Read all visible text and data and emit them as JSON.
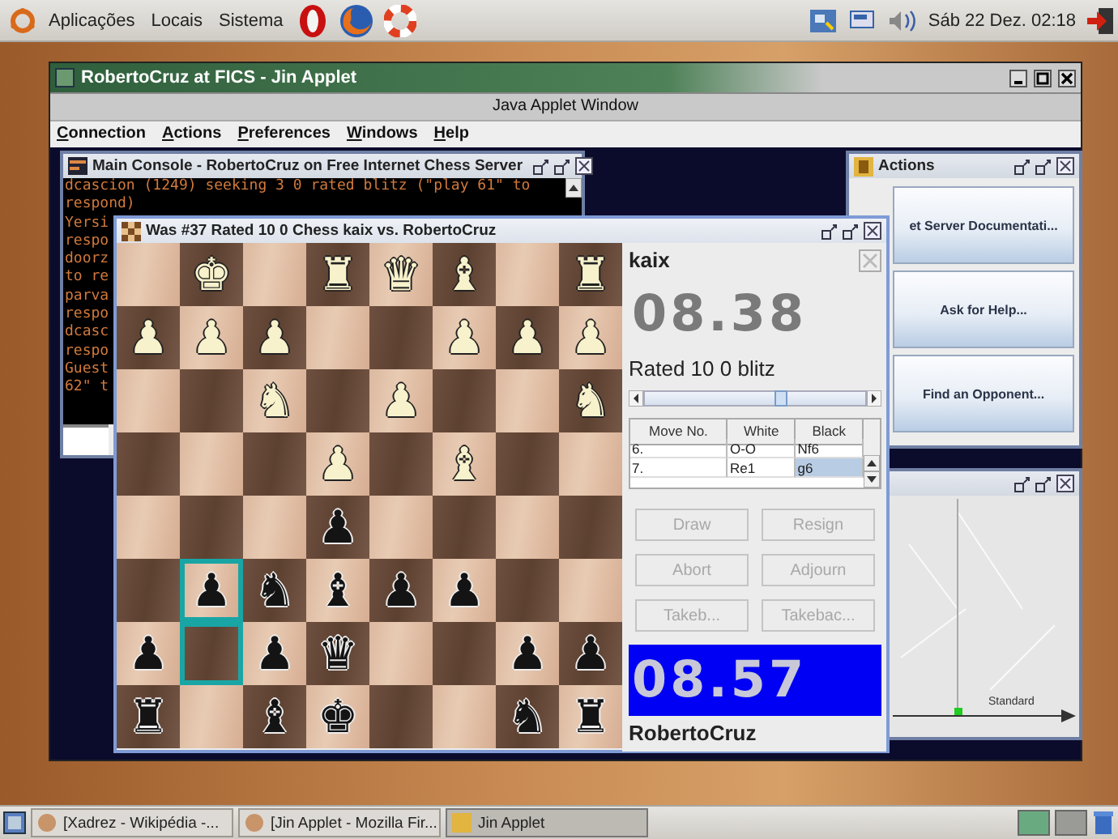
{
  "top_panel": {
    "menus": [
      "Aplicações",
      "Locais",
      "Sistema"
    ],
    "clock": "Sáb 22 Dez. 02:18"
  },
  "app_window": {
    "title": "RobertoCruz at FICS - Jin Applet",
    "banner": "Java Applet Window",
    "menu": [
      "Connection",
      "Actions",
      "Preferences",
      "Windows",
      "Help"
    ]
  },
  "console": {
    "title": "Main Console - RobertoCruz on Free Internet Chess Server",
    "lines": [
      "dcascion (1249) seeking 3 0 rated blitz (\"play 61\" to",
      "respond)",
      "Yersi",
      "respo",
      "doorz",
      "to re",
      "parva",
      "respo",
      "dcasc",
      "respo",
      "Guest",
      "62\" t"
    ]
  },
  "game": {
    "title": "Was #37 Rated 10 0 Chess kaix vs. RobertoCruz",
    "board": [
      [
        {
          "highlighted": false
        },
        {
          "piece": "♚",
          "kind": "white",
          "highlighted": false
        },
        {
          "highlighted": false
        },
        {
          "piece": "♜",
          "kind": "white",
          "highlighted": false
        },
        {
          "piece": "♛",
          "kind": "white",
          "highlighted": false
        },
        {
          "piece": "♝",
          "kind": "white",
          "highlighted": false
        },
        {
          "highlighted": false
        },
        {
          "piece": "♜",
          "kind": "white",
          "highlighted": false
        }
      ],
      [
        {
          "piece": "♟",
          "kind": "white",
          "highlighted": false
        },
        {
          "piece": "♟",
          "kind": "white",
          "highlighted": false
        },
        {
          "piece": "♟",
          "kind": "white",
          "highlighted": false
        },
        {
          "highlighted": false
        },
        {
          "highlighted": false
        },
        {
          "piece": "♟",
          "kind": "white",
          "highlighted": false
        },
        {
          "piece": "♟",
          "kind": "white",
          "highlighted": false
        },
        {
          "piece": "♟",
          "kind": "white",
          "highlighted": false
        }
      ],
      [
        {
          "highlighted": false
        },
        {
          "highlighted": false
        },
        {
          "piece": "♞",
          "kind": "white",
          "highlighted": false
        },
        {
          "highlighted": false
        },
        {
          "piece": "♟",
          "kind": "white",
          "highlighted": false
        },
        {
          "highlighted": false
        },
        {
          "highlighted": false
        },
        {
          "piece": "♞",
          "kind": "white",
          "highlighted": false
        }
      ],
      [
        {
          "highlighted": false
        },
        {
          "highlighted": false
        },
        {
          "highlighted": false
        },
        {
          "piece": "♟",
          "kind": "white",
          "highlighted": false
        },
        {
          "highlighted": false
        },
        {
          "piece": "♝",
          "kind": "white",
          "highlighted": false
        },
        {
          "highlighted": false
        },
        {
          "highlighted": false
        }
      ],
      [
        {
          "highlighted": false
        },
        {
          "highlighted": false
        },
        {
          "highlighted": false
        },
        {
          "piece": "♟",
          "kind": "black",
          "highlighted": false
        },
        {
          "highlighted": false
        },
        {
          "highlighted": false
        },
        {
          "highlighted": false
        },
        {
          "highlighted": false
        }
      ],
      [
        {
          "highlighted": false
        },
        {
          "piece": "♟",
          "kind": "black",
          "highlighted": true
        },
        {
          "piece": "♞",
          "kind": "black",
          "highlighted": false
        },
        {
          "piece": "♝",
          "kind": "black",
          "highlighted": false
        },
        {
          "piece": "♟",
          "kind": "black",
          "highlighted": false
        },
        {
          "piece": "♟",
          "kind": "black",
          "highlighted": false
        },
        {
          "highlighted": false
        },
        {
          "highlighted": false
        }
      ],
      [
        {
          "piece": "♟",
          "kind": "black",
          "highlighted": false
        },
        {
          "highlighted": true
        },
        {
          "piece": "♟",
          "kind": "black",
          "highlighted": false
        },
        {
          "piece": "♛",
          "kind": "black",
          "highlighted": false
        },
        {
          "highlighted": false
        },
        {
          "highlighted": false
        },
        {
          "piece": "♟",
          "kind": "black",
          "highlighted": false
        },
        {
          "piece": "♟",
          "kind": "black",
          "highlighted": false
        }
      ],
      [
        {
          "piece": "♜",
          "kind": "black",
          "highlighted": false
        },
        {
          "highlighted": false
        },
        {
          "piece": "♝",
          "kind": "black",
          "highlighted": false
        },
        {
          "piece": "♚",
          "kind": "black",
          "highlighted": false
        },
        {
          "highlighted": false
        },
        {
          "highlighted": false
        },
        {
          "piece": "♞",
          "kind": "black",
          "highlighted": false
        },
        {
          "piece": "♜",
          "kind": "black",
          "highlighted": false
        }
      ]
    ],
    "opponent": {
      "name": "kaix",
      "clock": "08.38",
      "active": false
    },
    "game_type": "Rated 10 0 blitz",
    "move_slider": {
      "level": 0.62
    },
    "moves": {
      "columns": [
        "Move No.",
        "White",
        "Black"
      ],
      "rows": [
        {
          "cells": [
            {
              "text": "6.",
              "selected": false
            },
            {
              "text": "O-O",
              "selected": false
            },
            {
              "text": "Nf6",
              "selected": false
            }
          ]
        },
        {
          "cells": [
            {
              "text": "7.",
              "selected": false
            },
            {
              "text": "Re1",
              "selected": false
            },
            {
              "text": "g6",
              "selected": true
            }
          ]
        }
      ]
    },
    "buttons": [
      {
        "label": "Draw",
        "disabled": true
      },
      {
        "label": "Resign",
        "disabled": true
      },
      {
        "label": "Abort",
        "disabled": true
      },
      {
        "label": "Adjourn",
        "disabled": true
      },
      {
        "label": "Takeb...",
        "disabled": true
      },
      {
        "label": "Takebac...",
        "disabled": true
      }
    ],
    "player": {
      "name": "RobertoCruz",
      "clock": "08.57",
      "active": true
    }
  },
  "actions": {
    "title": "Actions",
    "buttons": [
      "et Server Documentati...",
      "Ask for Help...",
      "Find an Opponent..."
    ]
  },
  "graph": {
    "axis_label": "Standard"
  },
  "taskbar": {
    "tasks": [
      {
        "label": "[Xadrez - Wikipédia -...",
        "selected": false
      },
      {
        "label": "[Jin Applet - Mozilla Fir...",
        "selected": false
      },
      {
        "label": "Jin Applet",
        "selected": true
      }
    ]
  }
}
